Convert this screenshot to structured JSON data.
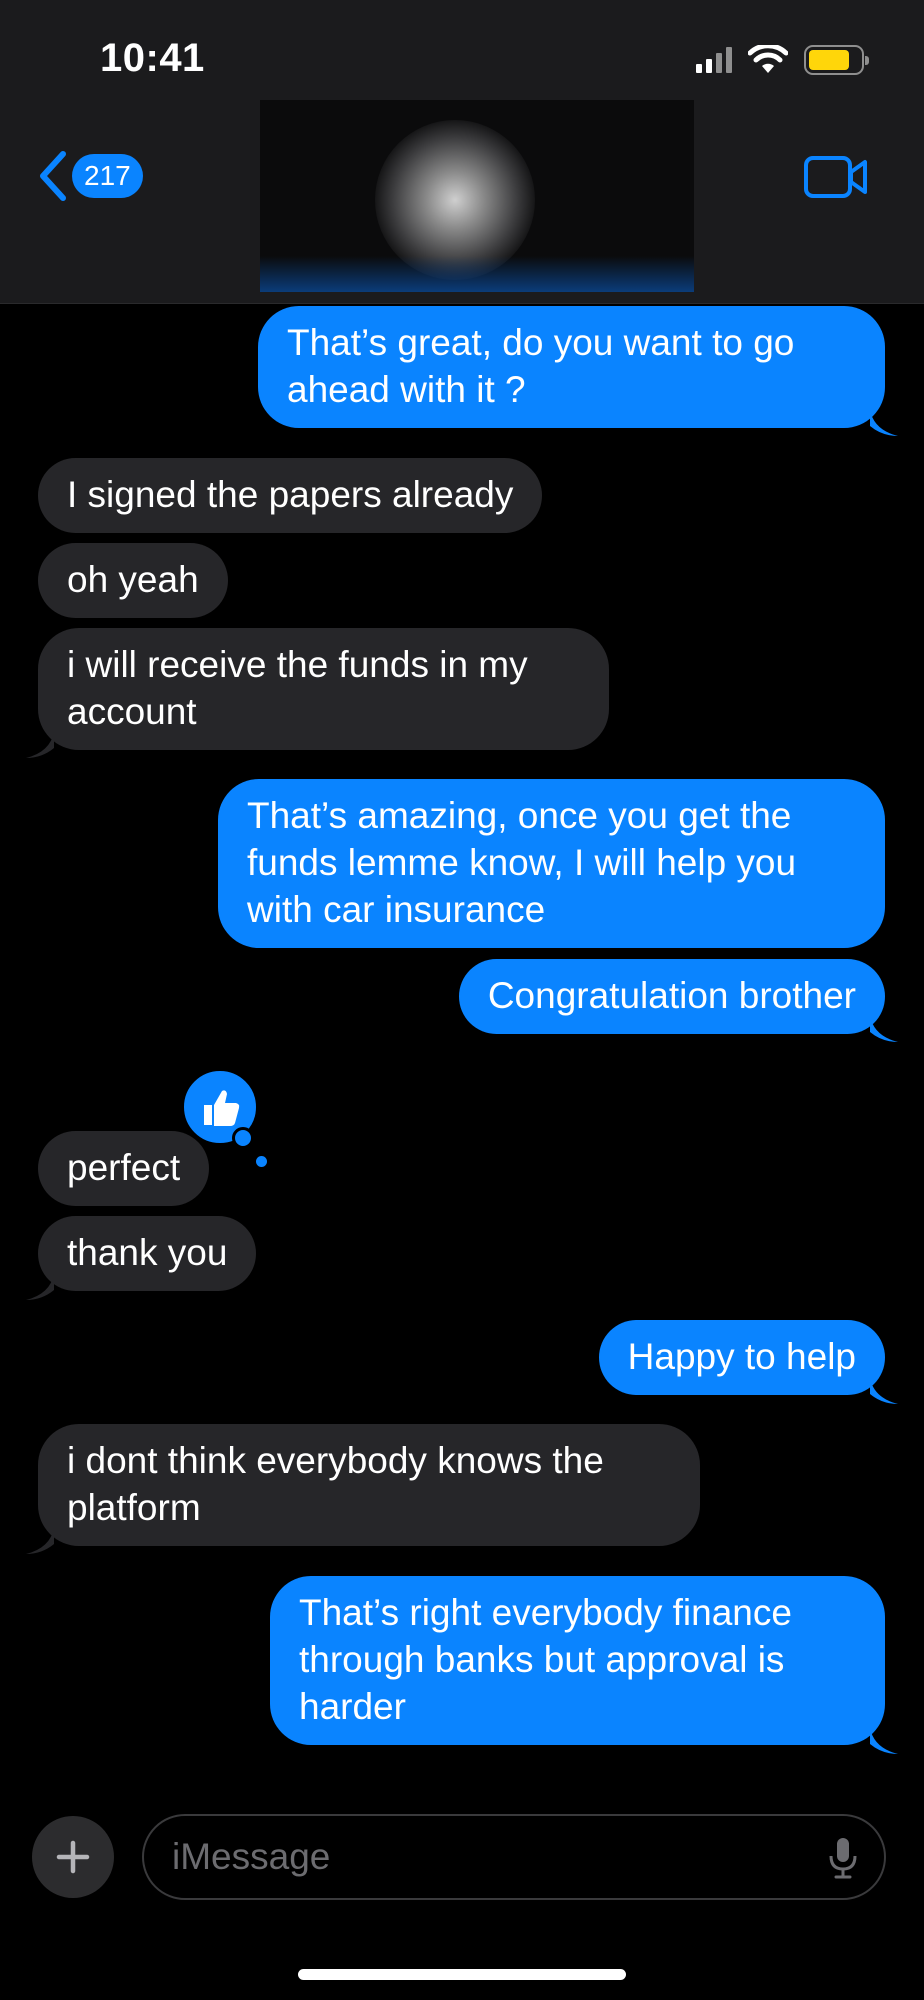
{
  "status": {
    "time": "10:41"
  },
  "nav": {
    "back_count": "217"
  },
  "messages": [
    {
      "side": "out",
      "text": "That’s great, do you want to go ahead with it ?"
    },
    {
      "side": "in",
      "text": "I signed the papers already"
    },
    {
      "side": "in",
      "text": "oh yeah"
    },
    {
      "side": "in",
      "text": "i will receive the funds in my account"
    },
    {
      "side": "out",
      "text": "That’s amazing, once you get the funds lemme know, I will help you with car insurance"
    },
    {
      "side": "out",
      "text": "Congratulation brother"
    },
    {
      "side": "in",
      "text": "perfect",
      "reaction": "thumbs-up"
    },
    {
      "side": "in",
      "text": "thank you"
    },
    {
      "side": "out",
      "text": "Happy to help"
    },
    {
      "side": "in",
      "text": "i dont think everybody knows the platform"
    },
    {
      "side": "out",
      "text": "That’s right everybody finance through banks but approval is harder"
    }
  ],
  "composer": {
    "placeholder": "iMessage"
  },
  "colors": {
    "outgoing": "#0a84ff",
    "incoming": "#262629",
    "background": "#000000",
    "battery": "#ffd60a"
  },
  "icons": [
    "back-chevron-icon",
    "video-camera-icon",
    "signal-icon",
    "wifi-icon",
    "battery-icon",
    "thumbs-up-icon",
    "plus-icon",
    "microphone-icon"
  ]
}
